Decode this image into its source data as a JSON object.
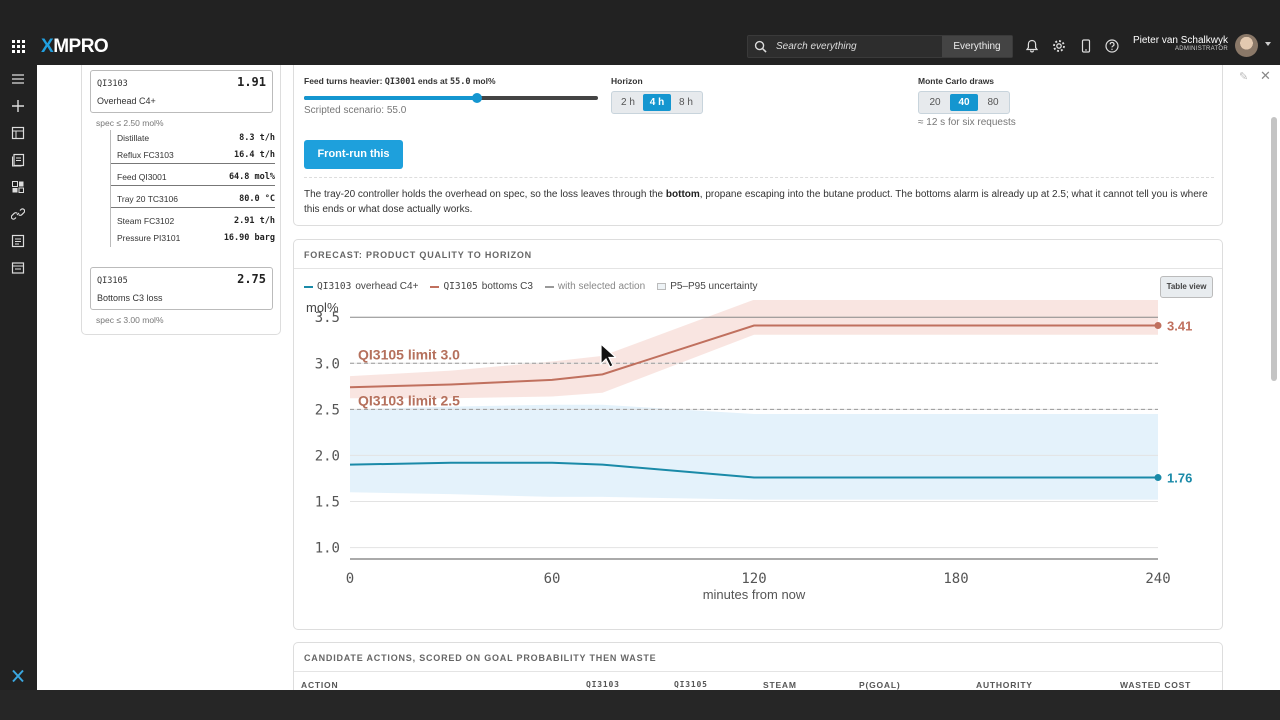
{
  "app": {
    "logo": "XMPRO"
  },
  "topbar": {
    "search_placeholder": "Search everything",
    "search_scope": "Everything",
    "user_name": "Pieter van Schalkwyk",
    "user_role": "ADMINISTRATOR"
  },
  "tags": {
    "qi3103": {
      "id": "QI3103",
      "value": "1.91",
      "label": "Overhead C4+",
      "spec": "spec ≤ 2.50 mol%"
    },
    "qi3105": {
      "id": "QI3105",
      "value": "2.75",
      "label": "Bottoms C3 loss",
      "spec": "spec ≤ 3.00 mol%"
    },
    "rows": [
      {
        "key": "Distillate",
        "value": "8.3 t/h"
      },
      {
        "key": "Reflux FC3103",
        "value": "16.4 t/h"
      },
      {
        "key": "Feed QI3001",
        "value": "64.8 mol%"
      },
      {
        "key": "Tray 20 TC3106",
        "value": "80.0 °C"
      },
      {
        "key": "Steam FC3102",
        "value": "2.91 t/h"
      },
      {
        "key": "Pressure PI3101",
        "value": "16.90 barg"
      }
    ]
  },
  "scenario": {
    "slider_title_prefix": "Feed turns heavier: ",
    "slider_title_mono": "QI3001",
    "slider_title_suffix": " ends at ",
    "slider_title_value": "55.0",
    "slider_title_unit": " mol%",
    "slider_fraction": 0.59,
    "scripted": "Scripted scenario: 55.0",
    "horizon_title": "Horizon",
    "horizon_options": [
      "2 h",
      "4 h",
      "8 h"
    ],
    "horizon_selected": "4 h",
    "mc_title": "Monte Carlo draws",
    "mc_options": [
      "20",
      "40",
      "80"
    ],
    "mc_selected": "40",
    "mc_note": "≈ 12 s for six requests",
    "front_run_button": "Front-run this",
    "para_1": "The tray-20 controller holds the overhead on spec, so the loss leaves through the ",
    "para_bold": "bottom",
    "para_2": ", propane escaping into the butane product. The bottoms alarm is already up at 2.5; what it cannot tell you is where this ends or what dose actually works."
  },
  "forecast": {
    "title": "FORECAST: PRODUCT QUALITY TO HORIZON",
    "table_view": "Table view",
    "legend": {
      "s1_id": "QI3103",
      "s1_name": " overhead C4+",
      "s2_id": "QI3105",
      "s2_name": " bottoms C3",
      "with_action": "with selected action",
      "uncertainty": "P5–P95 uncertainty"
    },
    "colors": {
      "overhead": "#1a8aa8",
      "bottoms": "#c0705e",
      "overhead_band": "#dff0fa",
      "bottoms_band": "#f8e1dc"
    }
  },
  "chart_data": {
    "type": "line",
    "ylabel": "mol%",
    "xlabel": "minutes from now",
    "xlim": [
      0,
      240
    ],
    "ylim": [
      0.8,
      3.6
    ],
    "xticks": [
      0,
      60,
      120,
      180,
      240
    ],
    "yticks": [
      1.0,
      1.5,
      2.0,
      2.5,
      3.0,
      3.5
    ],
    "limits": [
      {
        "label": "QI3105 limit 3.0",
        "y": 3.0
      },
      {
        "label": "QI3103 limit 2.5",
        "y": 2.5
      }
    ],
    "series": [
      {
        "name": "QI3103 overhead C4+",
        "x": [
          0,
          30,
          60,
          75,
          120,
          180,
          240
        ],
        "y": [
          1.9,
          1.92,
          1.92,
          1.9,
          1.76,
          1.76,
          1.76
        ],
        "p5": [
          1.6,
          1.58,
          1.55,
          1.55,
          1.52,
          1.52,
          1.52
        ],
        "p95": [
          2.5,
          2.53,
          2.55,
          2.55,
          2.45,
          2.45,
          2.45
        ],
        "end_label": "1.76"
      },
      {
        "name": "QI3105 bottoms C3",
        "x": [
          0,
          30,
          60,
          75,
          120,
          180,
          240
        ],
        "y": [
          2.74,
          2.77,
          2.82,
          2.88,
          3.41,
          3.41,
          3.41
        ],
        "p5": [
          2.62,
          2.62,
          2.64,
          2.68,
          3.31,
          3.31,
          3.31
        ],
        "p95": [
          2.86,
          2.92,
          3.02,
          3.08,
          3.69,
          3.69,
          3.69
        ],
        "end_label": "3.41"
      }
    ]
  },
  "actions_table": {
    "title": "CANDIDATE ACTIONS, SCORED ON GOAL PROBABILITY THEN WASTE",
    "columns": [
      "ACTION",
      "QI3103",
      "QI3105",
      "STEAM",
      "P(GOAL)",
      "AUTHORITY",
      "WASTED COST"
    ]
  }
}
